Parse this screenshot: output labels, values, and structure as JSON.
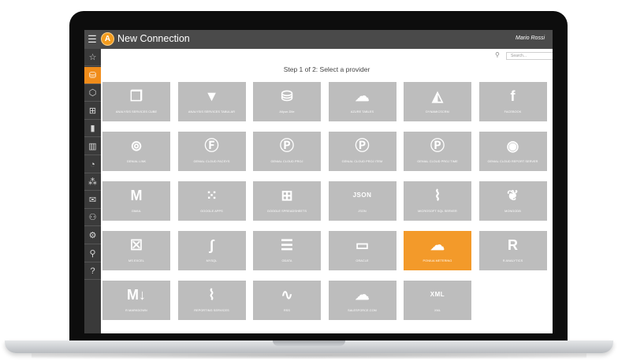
{
  "app": {
    "title": "New Connection",
    "user": "Mario Rossi",
    "logo_letter": "A"
  },
  "search": {
    "placeholder": "Search..."
  },
  "step": {
    "title": "Step 1 of 2: Select a provider"
  },
  "colors": {
    "accent": "#f08c1a",
    "tile": "#bdbdbd",
    "topbar": "#4a4a4a",
    "sidebar": "#3a3a3a"
  },
  "sidebar": {
    "items": [
      {
        "icon": "star-icon",
        "glyph": "☆",
        "active": false
      },
      {
        "icon": "database-icon",
        "glyph": "⛁",
        "active": true
      },
      {
        "icon": "cube-icon",
        "glyph": "⬡",
        "active": false
      },
      {
        "icon": "grid-icon",
        "glyph": "⊞",
        "active": false
      },
      {
        "icon": "bar-chart-icon",
        "glyph": "▮",
        "active": false
      },
      {
        "icon": "stacked-chart-icon",
        "glyph": "▥",
        "active": false
      },
      {
        "icon": "gauge-icon",
        "glyph": "◔",
        "active": false
      },
      {
        "icon": "network-icon",
        "glyph": "⁂",
        "active": false
      },
      {
        "icon": "mail-icon",
        "glyph": "✉",
        "active": false
      },
      {
        "icon": "users-icon",
        "glyph": "⚇",
        "active": false
      },
      {
        "icon": "gear-icon",
        "glyph": "⚙",
        "active": false
      },
      {
        "icon": "search-icon",
        "glyph": "⚲",
        "active": false
      },
      {
        "icon": "help-icon",
        "glyph": "?",
        "active": false
      }
    ]
  },
  "providers": [
    {
      "label": "ANALYSIS SERVICES CUBE",
      "icon": "cubes-icon",
      "glyph": "❒"
    },
    {
      "label": "ANALYSIS SERVICES TABULAR",
      "icon": "tabular-icon",
      "glyph": "▼"
    },
    {
      "label": "Aliyun-Dile",
      "icon": "database-stack-icon",
      "glyph": "⛁"
    },
    {
      "label": "AZURE TABLES",
      "icon": "cloud-windows-icon",
      "glyph": "☁"
    },
    {
      "label": "DYNAMICSCRM",
      "icon": "dynamics-icon",
      "glyph": "◭"
    },
    {
      "label": "FACEBOOK",
      "icon": "facebook-icon",
      "glyph": "f"
    },
    {
      "label": "GENIAL LINK",
      "icon": "link-icon",
      "glyph": "⊚"
    },
    {
      "label": "GENIAL CLOUD FACSYS",
      "icon": "letter-f-icon",
      "glyph": "Ⓕ"
    },
    {
      "label": "GENIAL CLOUD PROJ",
      "icon": "letter-p-icon",
      "glyph": "Ⓟ"
    },
    {
      "label": "GENIAL CLOUD PROJ ITEM",
      "icon": "letter-p-icon",
      "glyph": "Ⓟ"
    },
    {
      "label": "GENIAL CLOUD PROJ TIME",
      "icon": "letter-p-icon",
      "glyph": "Ⓟ"
    },
    {
      "label": "GENIAL CLOUD REPORT SERVER",
      "icon": "report-server-icon",
      "glyph": "◉"
    },
    {
      "label": "GMAIL",
      "icon": "gmail-icon",
      "glyph": "M"
    },
    {
      "label": "GOOGLE APPS",
      "icon": "apps-grid-icon",
      "glyph": "⁙"
    },
    {
      "label": "GOOGLE SPREADSHEETS",
      "icon": "spreadsheet-icon",
      "glyph": "⊞"
    },
    {
      "label": "JSON",
      "icon": "json-file-icon",
      "glyph": "JSON"
    },
    {
      "label": "MICROSOFT SQL SERVER",
      "icon": "sql-server-icon",
      "glyph": "⌇"
    },
    {
      "label": "MONGODB",
      "icon": "leaf-icon",
      "glyph": "❦"
    },
    {
      "label": "MS EXCEL",
      "icon": "excel-icon",
      "glyph": "☒"
    },
    {
      "label": "MYSQL",
      "icon": "dolphin-icon",
      "glyph": "∫"
    },
    {
      "label": "ODATA",
      "icon": "odata-icon",
      "glyph": "☰"
    },
    {
      "label": "ORACLE",
      "icon": "oracle-icon",
      "glyph": "▭"
    },
    {
      "label": "PONIUA METERING",
      "icon": "cloud-doc-icon",
      "glyph": "☁"
    },
    {
      "label": "R ANALYTICS",
      "icon": "r-logo-icon",
      "glyph": "R"
    },
    {
      "label": "R MARKDOWN",
      "icon": "markdown-icon",
      "glyph": "M↓"
    },
    {
      "label": "REPORTING SERVICES",
      "icon": "reporting-services-icon",
      "glyph": "⌇"
    },
    {
      "label": "RSS",
      "icon": "rss-icon",
      "glyph": "∿"
    },
    {
      "label": "SALESFORCE.COM",
      "icon": "salesforce-cloud-icon",
      "glyph": "☁"
    },
    {
      "label": "XML",
      "icon": "xml-file-icon",
      "glyph": "XML"
    }
  ],
  "selected_provider": "PONIUA METERING"
}
